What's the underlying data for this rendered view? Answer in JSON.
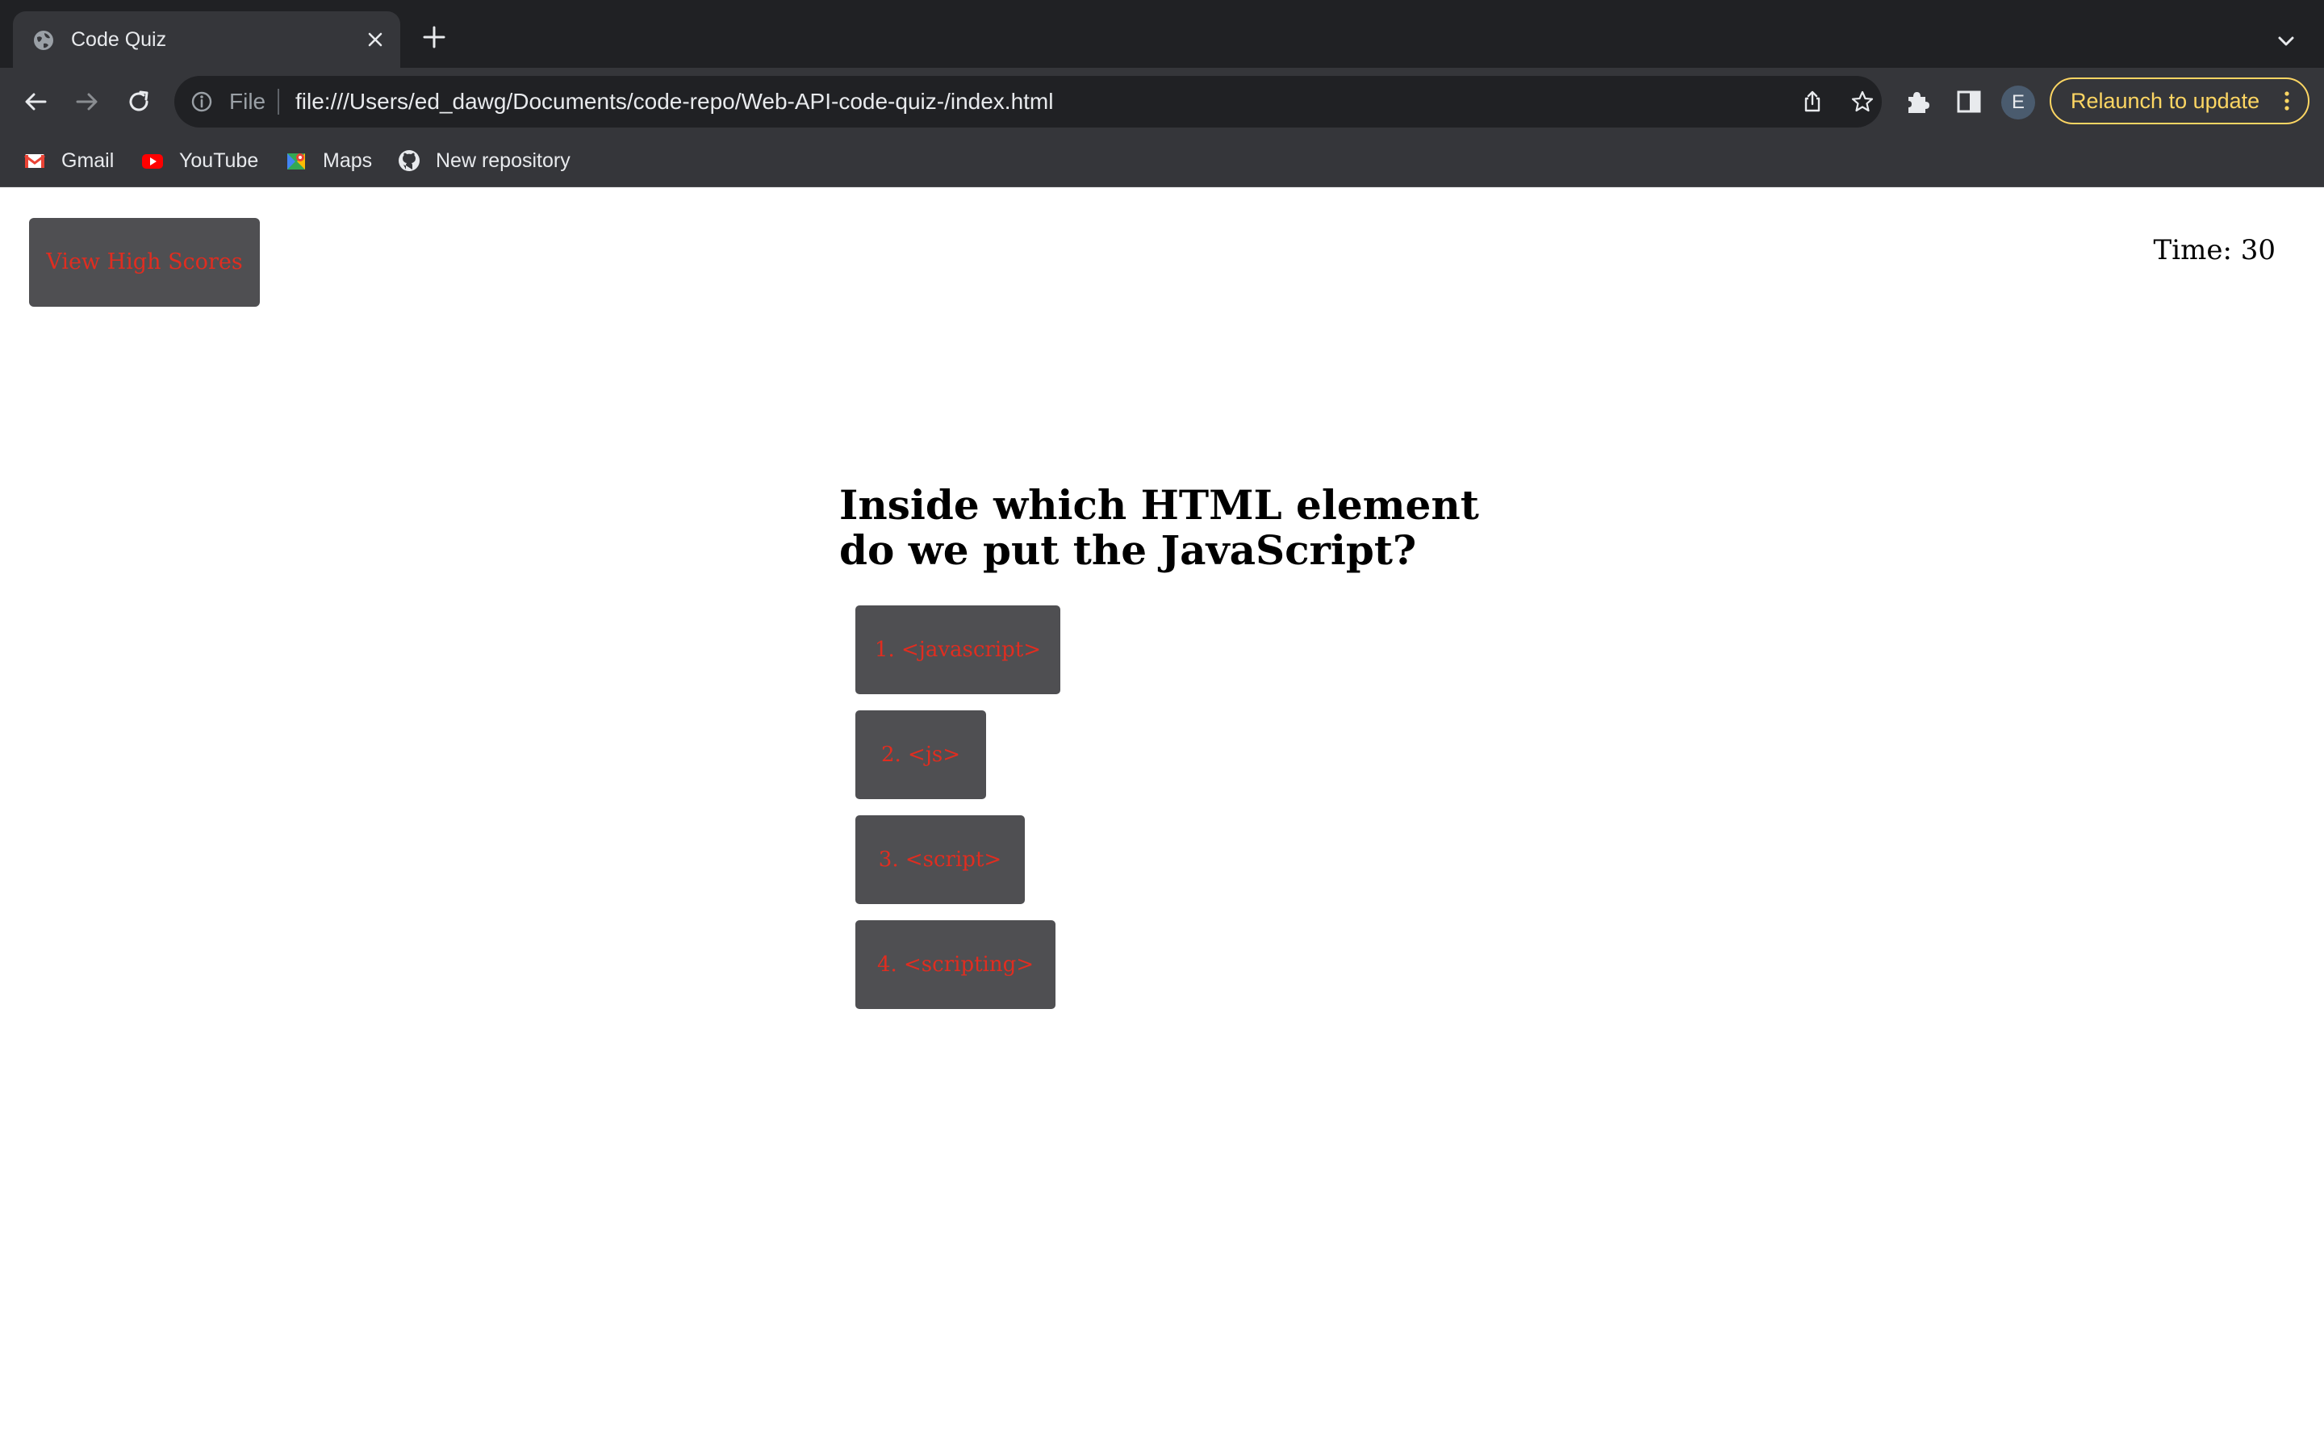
{
  "browser": {
    "tab_title": "Code Quiz",
    "omnibox": {
      "scheme_label": "File",
      "url": "file:///Users/ed_dawg/Documents/code-repo/Web-API-code-quiz-/index.html"
    },
    "profile_initial": "E",
    "relaunch_label": "Relaunch to update",
    "accent_color": "#fdd663",
    "bookmarks": [
      {
        "label": "Gmail",
        "icon": "gmail-icon"
      },
      {
        "label": "YouTube",
        "icon": "youtube-icon"
      },
      {
        "label": "Maps",
        "icon": "maps-icon"
      },
      {
        "label": "New repository",
        "icon": "github-icon"
      }
    ]
  },
  "page": {
    "high_scores_label": "View High Scores",
    "timer_text": "Time: 30",
    "question": "Inside which HTML element do we put the JavaScript?",
    "answers": [
      "1. <javascript>",
      "2. <js>",
      "3. <script>",
      "4. <scripting>"
    ],
    "button_bg_color": "#4f4f52",
    "button_text_color": "#e02d20"
  }
}
